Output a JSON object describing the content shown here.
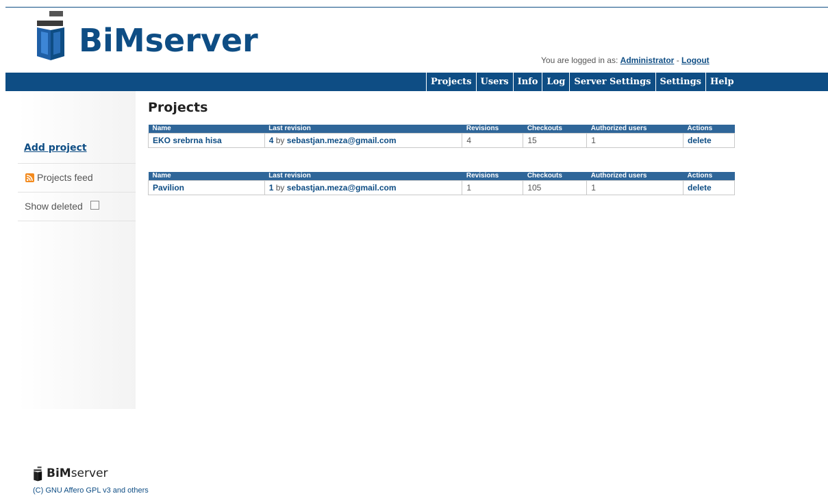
{
  "brand": {
    "logo_bold": "BiM",
    "logo_rest": "server",
    "primary_color": "#0e4d84",
    "header_color": "#2f6699"
  },
  "login": {
    "prefix": "You are logged in as:",
    "user": "Administrator",
    "separator": "-",
    "logout": "Logout"
  },
  "nav": {
    "items": [
      "Projects",
      "Users",
      "Info",
      "Log",
      "Server Settings",
      "Settings",
      "Help"
    ]
  },
  "sidebar": {
    "add_project": "Add project",
    "projects_feed": "Projects feed",
    "feed_icon": "rss-icon",
    "show_deleted": "Show deleted",
    "show_deleted_checked": false
  },
  "main": {
    "title": "Projects",
    "columns": [
      "Name",
      "Last revision",
      "Revisions",
      "Checkouts",
      "Authorized users",
      "Actions"
    ],
    "projects": [
      {
        "name": "EKO srebrna hisa",
        "last_revision_num": "4",
        "last_revision_by": "by",
        "last_revision_user": "sebastjan.meza@gmail.com",
        "revisions": "4",
        "checkouts": "15",
        "authorized_users": "1",
        "action": "delete"
      },
      {
        "name": "Pavilion",
        "last_revision_num": "1",
        "last_revision_by": "by",
        "last_revision_user": "sebastjan.meza@gmail.com",
        "revisions": "1",
        "checkouts": "105",
        "authorized_users": "1",
        "action": "delete"
      }
    ]
  },
  "footer": {
    "logo_bold": "BiM",
    "logo_rest": "server",
    "copyright": "(C) GNU Affero GPL v3 and others"
  }
}
